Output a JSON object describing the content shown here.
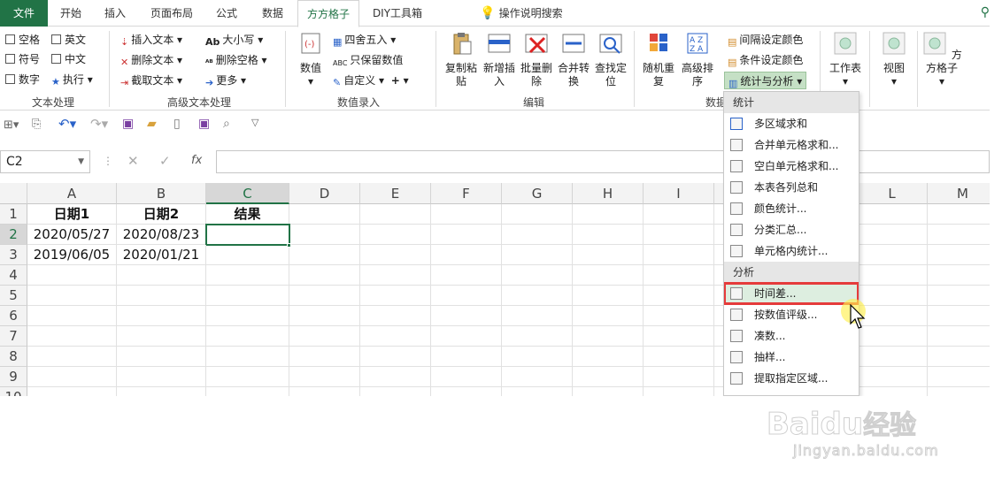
{
  "tabs": [
    {
      "label": "文件"
    },
    {
      "label": "开始"
    },
    {
      "label": "插入"
    },
    {
      "label": "页面布局"
    },
    {
      "label": "公式"
    },
    {
      "label": "数据"
    },
    {
      "label": "方方格子"
    },
    {
      "label": "DIY工具箱"
    }
  ],
  "tell_me": "操作说明搜索",
  "ribbon": {
    "text_group": {
      "label": "文本处理",
      "items": [
        "空格",
        "英文",
        "符号",
        "中文",
        "数字",
        "执行"
      ]
    },
    "adv_text": {
      "label": "高级文本处理",
      "items": [
        "插入文本",
        "删除文本",
        "截取文本",
        "大小写",
        "删除空格",
        "更多"
      ]
    },
    "num_input": {
      "label": "数值录入",
      "items": [
        "数值",
        "四舍五入",
        "只保留数值",
        "自定义"
      ]
    },
    "edit": {
      "label": "编辑",
      "items": [
        "复制粘贴",
        "新增插入",
        "批量删除",
        "合并转换",
        "查找定位"
      ]
    },
    "data_grp": {
      "label": "数据",
      "items": [
        "随机重复",
        "高级排序",
        "间隔设定颜色",
        "条件设定颜色",
        "统计与分析"
      ]
    },
    "right": [
      "工作表",
      "视图",
      "方方格子"
    ]
  },
  "formula_bar": {
    "name_box": "C2",
    "fx": "fx"
  },
  "columns": [
    "A",
    "B",
    "C",
    "D",
    "E",
    "F",
    "G",
    "H",
    "I",
    "",
    "L",
    "M"
  ],
  "rows": [
    "1",
    "2",
    "3",
    "4",
    "5",
    "6",
    "7",
    "8",
    "9",
    "10"
  ],
  "cells": {
    "A1": "日期1",
    "B1": "日期2",
    "C1": "结果",
    "A2": "2020/05/27",
    "B2": "2020/08/23",
    "A3": "2019/06/05",
    "B3": "2020/01/21"
  },
  "menu": {
    "section1": "统计",
    "items1": [
      "多区域求和",
      "合并单元格求和...",
      "空白单元格求和...",
      "本表各列总和",
      "颜色统计...",
      "分类汇总...",
      "单元格内统计..."
    ],
    "section2": "分析",
    "items2": [
      "时间差...",
      "按数值评级...",
      "凑数...",
      "抽样...",
      "提取指定区域..."
    ]
  },
  "watermark": {
    "brand": "Baidu",
    "cn": "经验",
    "url": "jingyan.baidu.com"
  }
}
